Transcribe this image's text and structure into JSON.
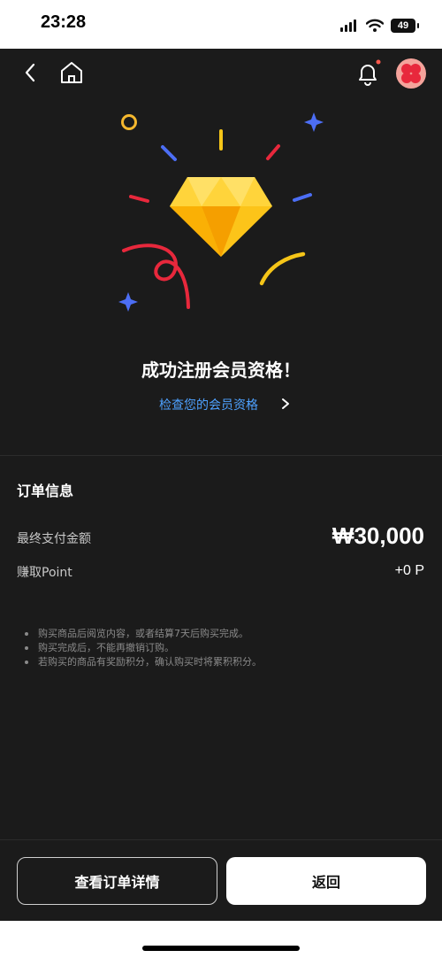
{
  "status_bar": {
    "time": "23:28",
    "battery": "49"
  },
  "nav": {
    "back_icon": "chevron-left-icon",
    "home_icon": "home-icon",
    "bell_icon": "bell-icon",
    "has_notification": true
  },
  "success": {
    "title": "成功注册会员资格！",
    "link_label": "检查您的会员资格"
  },
  "order": {
    "title": "订单信息",
    "final_payment_label": "最终支付金额",
    "final_payment_value": "₩30,000",
    "points_label": "赚取Point",
    "points_value": "+0 P"
  },
  "notes": [
    "购买商品后阅览内容，或者结算7天后购买完成。",
    "购买完成后，不能再撤销订购。",
    "若购买的商品有奖励积分，确认购买时将累积积分。"
  ],
  "buttons": {
    "view_details": "查看订单详情",
    "back": "返回"
  },
  "colors": {
    "background": "#1b1b1b",
    "link": "#4ea1ff",
    "diamond": "#fcc419",
    "confetti_red": "#e8283c",
    "confetti_blue": "#4c6ef5"
  }
}
